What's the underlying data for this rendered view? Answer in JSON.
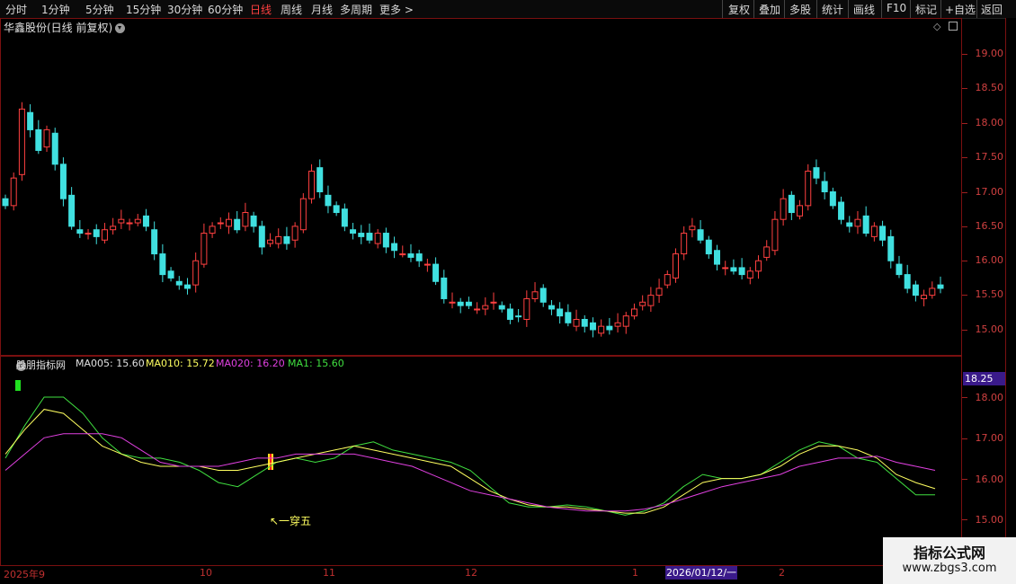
{
  "toolbar": {
    "periods": [
      "分时",
      "1分钟",
      "5分钟",
      "15分钟",
      "30分钟",
      "60分钟",
      "日线",
      "周线",
      "月线",
      "多周期",
      "更多 >"
    ],
    "active_period": "日线",
    "actions": [
      "复权",
      "叠加",
      "多股",
      "统计",
      "画线",
      "F10",
      "标记",
      "+自选",
      "返回"
    ]
  },
  "stock": {
    "title": "华鑫股份(日线 前复权)"
  },
  "price_axis": [
    "19.00",
    "18.50",
    "18.00",
    "17.50",
    "17.00",
    "16.50",
    "16.00",
    "15.50",
    "15.00"
  ],
  "indicator": {
    "name": "股朋指标网",
    "ma005": "MA005: 15.60",
    "ma010": "MA010: 15.72",
    "ma020": "MA020: 16.20",
    "ma1": "MA1: 15.60",
    "axis": [
      "18.00",
      "17.00",
      "16.00",
      "15.00"
    ],
    "current_badge": "18.25",
    "annotation": "↖一穿五"
  },
  "time_axis": {
    "labels": [
      "2025年9",
      "10",
      "11",
      "12",
      "1",
      "2"
    ],
    "cursor_date": "2026/01/12/一"
  },
  "colors": {
    "up": "#ff4040",
    "down": "#40e0e0",
    "ma005": "#ffff60",
    "ma010": "#40e040",
    "ma020": "#e040e0",
    "badge": "#3a1a8a"
  },
  "watermark": {
    "title": "指标公式网",
    "url": "www.zbgs3.com"
  }
}
